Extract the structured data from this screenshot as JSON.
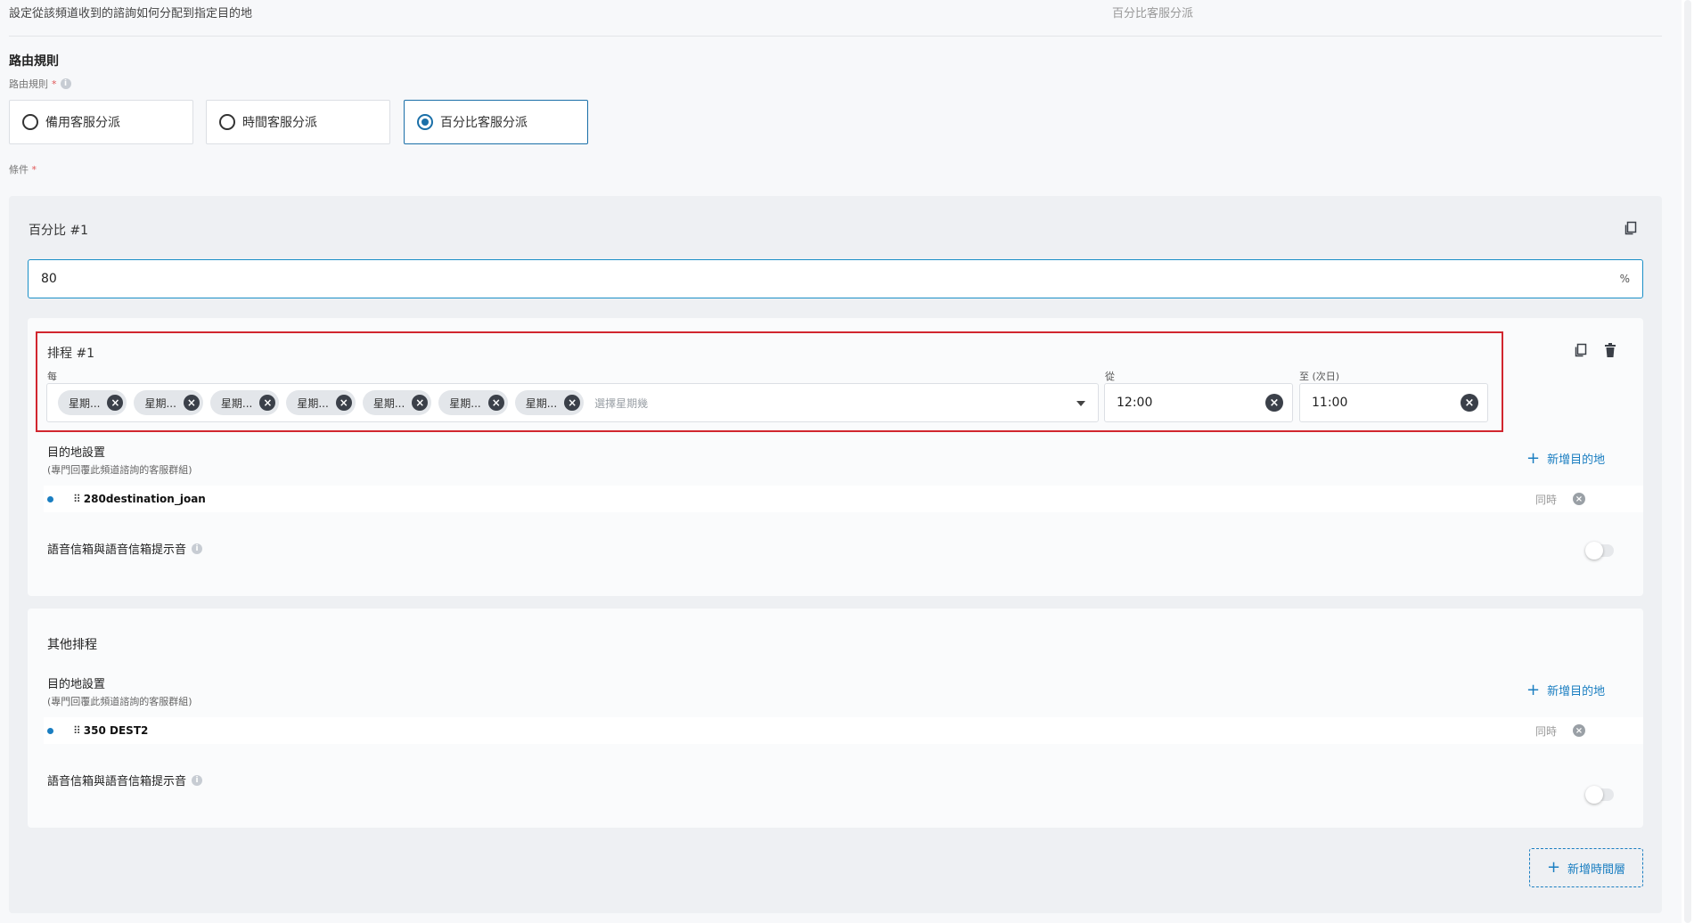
{
  "header": {
    "description": "設定從該頻道收到的諮詢如何分配到指定目的地",
    "current_rule": "百分比客服分派"
  },
  "routing": {
    "section_title": "路由規則",
    "field_label": "路由規則",
    "required_mark": "*",
    "options": [
      {
        "label": "備用客服分派",
        "selected": false
      },
      {
        "label": "時間客服分派",
        "selected": false
      },
      {
        "label": "百分比客服分派",
        "selected": true
      }
    ],
    "condition_label": "條件",
    "condition_required": "*"
  },
  "percentage": {
    "title": "百分比 #1",
    "value": "80",
    "unit": "%"
  },
  "schedule": {
    "title": "排程 #1",
    "every_label": "每",
    "day_chips": [
      "星期...",
      "星期...",
      "星期...",
      "星期...",
      "星期...",
      "星期...",
      "星期..."
    ],
    "days_placeholder": "選擇星期幾",
    "from_label": "從",
    "from_value": "12:00",
    "to_label": "至 (次日)",
    "to_value": "11:00"
  },
  "destination": {
    "title": "目的地設置",
    "subtitle": "(專門回覆此頻道諮詢的客服群組)",
    "add_label": "新增目的地",
    "items": [
      {
        "name": "280destination_joan",
        "mode": "同時"
      }
    ],
    "voicemail_label": "語音信箱與語音信箱提示音"
  },
  "other": {
    "title": "其他排程",
    "destination_title": "目的地設置",
    "destination_subtitle": "(專門回覆此頻道諮詢的客服群組)",
    "add_label": "新增目的地",
    "items": [
      {
        "name": "350 DEST2",
        "mode": "同時"
      }
    ],
    "voicemail_label": "語音信箱與語音信箱提示音"
  },
  "add_time_layer_label": "新增時間層",
  "colors": {
    "accent": "#1a7ec1",
    "highlight_border": "#d1262f"
  }
}
